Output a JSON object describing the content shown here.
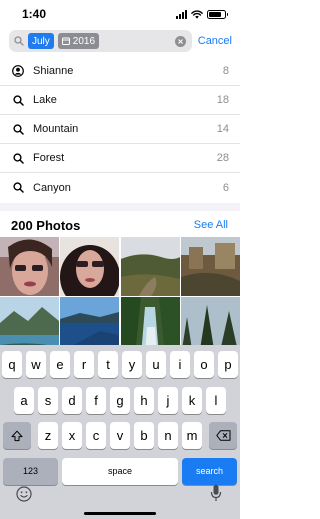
{
  "status_bar": {
    "time": "1:40"
  },
  "search": {
    "tokens": [
      {
        "label": "July",
        "type": "month"
      },
      {
        "label": "2016",
        "type": "year"
      }
    ],
    "cancel_label": "Cancel"
  },
  "suggestions": [
    {
      "icon": "person-icon",
      "label": "Shianne",
      "count": "8"
    },
    {
      "icon": "magnifier-icon",
      "label": "Lake",
      "count": "18"
    },
    {
      "icon": "magnifier-icon",
      "label": "Mountain",
      "count": "14"
    },
    {
      "icon": "magnifier-icon",
      "label": "Forest",
      "count": "28"
    },
    {
      "icon": "magnifier-icon",
      "label": "Canyon",
      "count": "6"
    }
  ],
  "photos": {
    "title": "200 Photos",
    "see_all_label": "See All"
  },
  "keyboard": {
    "row1": [
      "q",
      "w",
      "e",
      "r",
      "t",
      "y",
      "u",
      "i",
      "o",
      "p"
    ],
    "row2": [
      "a",
      "s",
      "d",
      "f",
      "g",
      "h",
      "j",
      "k",
      "l"
    ],
    "row3": [
      "z",
      "x",
      "c",
      "v",
      "b",
      "n",
      "m"
    ],
    "numbers_label": "123",
    "space_label": "space",
    "search_label": "search"
  },
  "colors": {
    "accent": "#1a7cf2",
    "keyboard_bg": "#d1d3d9"
  }
}
